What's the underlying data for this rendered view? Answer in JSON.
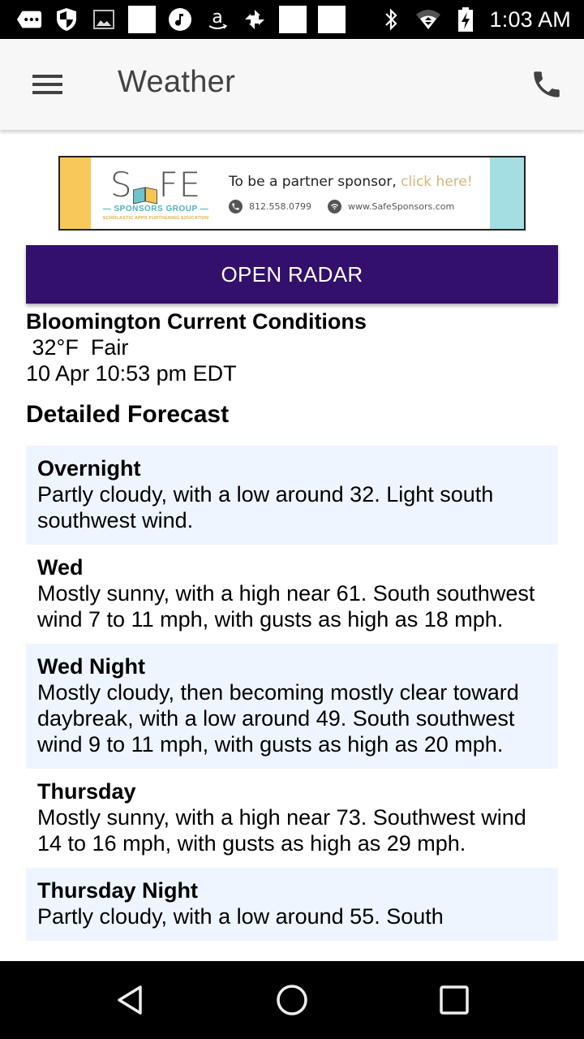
{
  "status_bar": {
    "left_icons": [
      "messages-icon",
      "shield-icon",
      "gallery-icon",
      "blank-notification-icon",
      "music-icon",
      "amazon-icon",
      "pinwheel-icon",
      "blank-notification-icon",
      "blank-notification-icon"
    ],
    "right_icons": [
      "bluetooth-icon",
      "wifi-icon",
      "battery-charging-icon"
    ],
    "time": "1:03 AM"
  },
  "app_bar": {
    "title": "Weather",
    "menu_icon": "menu-icon",
    "action_icon": "phone-icon"
  },
  "ad": {
    "logo_text_left": "S",
    "logo_text_right": "FE",
    "logo_group": "— SPONSORS GROUP —",
    "logo_tagline": "SCHOLASTIC APPS FURTHERING EDUCATION",
    "headline": "To be a partner sponsor, ",
    "headline_cta": "click here!",
    "phone": "812.558.0799",
    "website": "www.SafeSponsors.com",
    "colors": {
      "left_stripe": "#f9c85a",
      "right_stripe": "#a4dde2",
      "cta": "#d4b47a"
    }
  },
  "radar_button": {
    "label": "OPEN RADAR",
    "color": "#33106b"
  },
  "current_conditions": {
    "title": "Bloomington Current Conditions",
    "temp_line": " 32°F  Fair",
    "updated": "10 Apr 10:53 pm EDT"
  },
  "forecast": {
    "heading": "Detailed Forecast",
    "items": [
      {
        "period": "Overnight",
        "text": "Partly cloudy, with a low around 32. Light south southwest wind."
      },
      {
        "period": "Wed",
        "text": "Mostly sunny, with a high near 61. South southwest wind 7 to 11 mph, with gusts as high as 18 mph."
      },
      {
        "period": "Wed Night",
        "text": "Mostly cloudy, then becoming mostly clear toward daybreak, with a low around 49. South southwest wind 9 to 11 mph, with gusts as high as 20 mph."
      },
      {
        "period": "Thursday",
        "text": "Mostly sunny, with a high near 73. Southwest wind 14 to 16 mph, with gusts as high as 29 mph."
      },
      {
        "period": "Thursday Night",
        "text": "Partly cloudy, with a low around 55. South"
      }
    ],
    "shaded_color": "#eef5fe"
  },
  "nav_bar": {
    "buttons": [
      "back-icon",
      "home-icon",
      "recents-icon"
    ]
  }
}
